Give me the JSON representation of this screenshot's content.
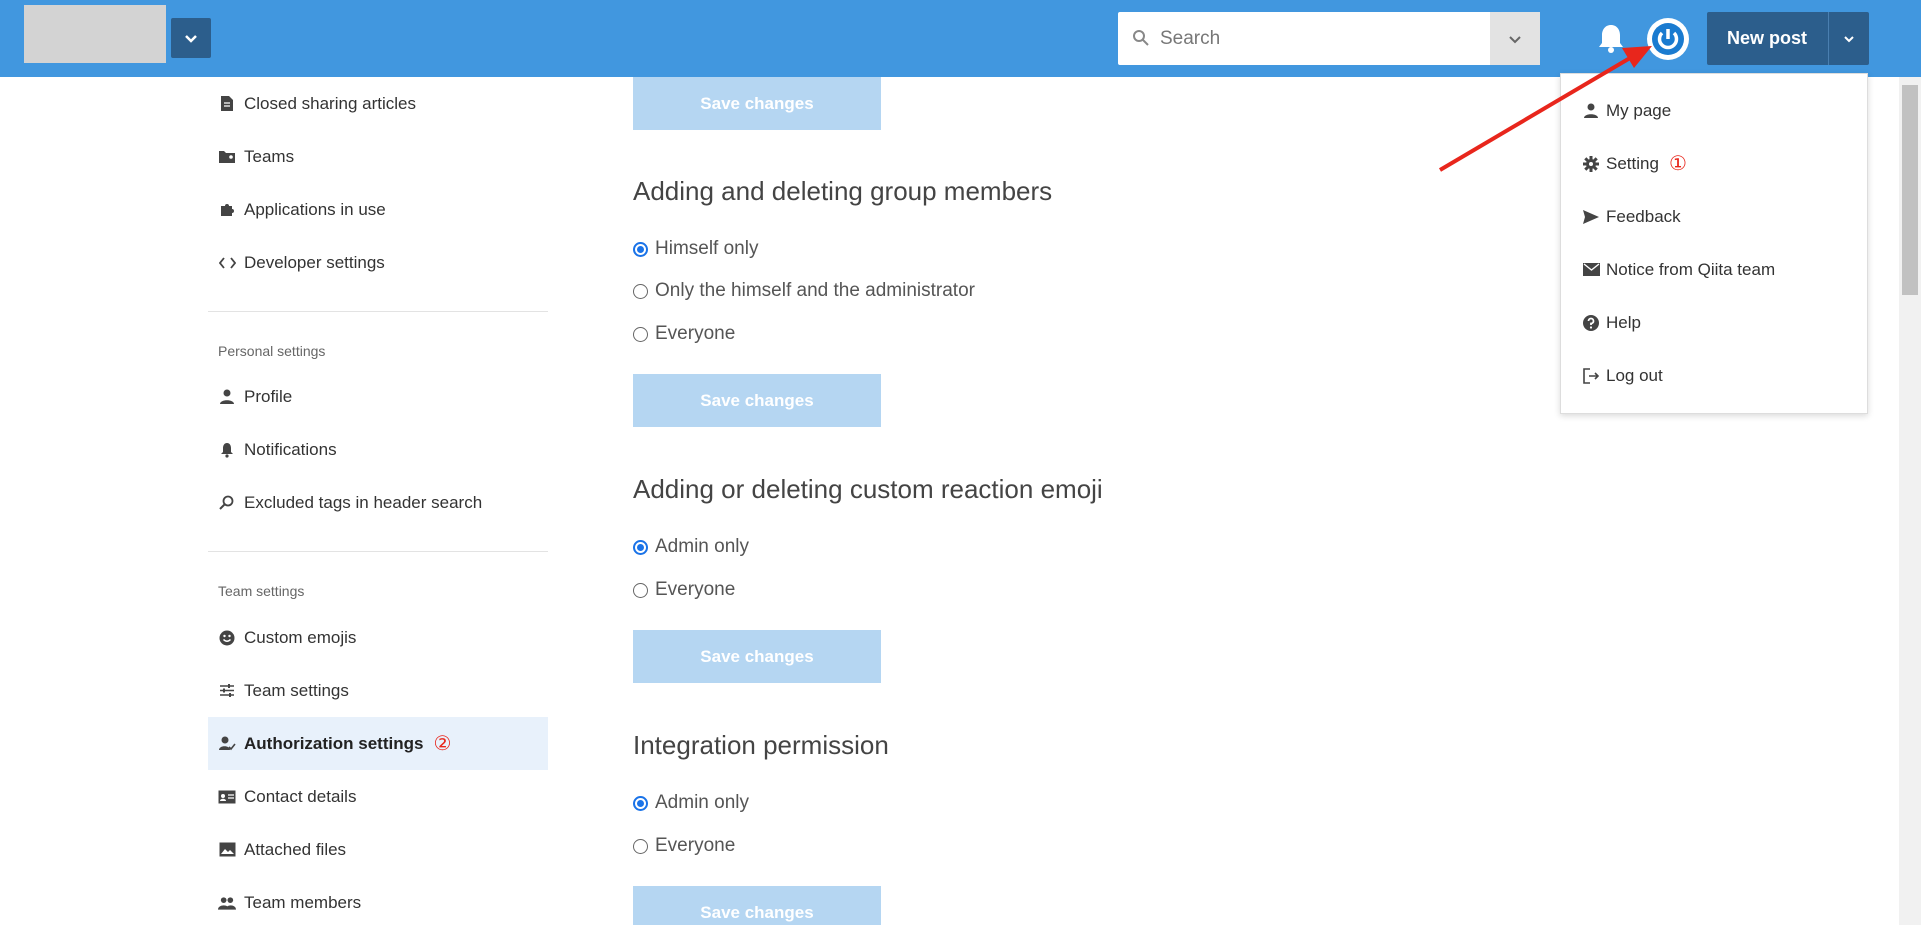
{
  "header": {
    "search_placeholder": "Search",
    "new_post_label": "New post",
    "accent_color": "#4197df",
    "dark_color": "#2c5e8c"
  },
  "sidebar": {
    "top_items": [
      {
        "label": "Closed sharing articles",
        "icon": "document-icon"
      },
      {
        "label": "Teams",
        "icon": "folder-team-icon"
      },
      {
        "label": "Applications in use",
        "icon": "puzzle-icon"
      },
      {
        "label": "Developer settings",
        "icon": "code-icon"
      }
    ],
    "personal_heading": "Personal settings",
    "personal_items": [
      {
        "label": "Profile",
        "icon": "person-icon"
      },
      {
        "label": "Notifications",
        "icon": "bell-icon"
      },
      {
        "label": "Excluded tags in header search",
        "icon": "tag-search-icon"
      }
    ],
    "team_heading": "Team settings",
    "team_items": [
      {
        "label": "Custom emojis",
        "icon": "smiley-icon"
      },
      {
        "label": "Team settings",
        "icon": "sliders-icon"
      },
      {
        "label": "Authorization settings",
        "icon": "user-check-icon",
        "active": true,
        "annotation": "②"
      },
      {
        "label": "Contact details",
        "icon": "contact-card-icon"
      },
      {
        "label": "Attached files",
        "icon": "image-icon"
      },
      {
        "label": "Team members",
        "icon": "people-icon"
      }
    ]
  },
  "main": {
    "save_label": "Save changes",
    "sections": [
      {
        "title": "Adding and deleting group members",
        "options": [
          "Himself only",
          "Only the himself and the administrator",
          "Everyone"
        ],
        "selected": 0
      },
      {
        "title": "Adding or deleting custom reaction emoji",
        "options": [
          "Admin only",
          "Everyone"
        ],
        "selected": 0
      },
      {
        "title": "Integration permission",
        "options": [
          "Admin only",
          "Everyone"
        ],
        "selected": 0
      }
    ]
  },
  "menu": {
    "items": [
      {
        "label": "My page",
        "icon": "person-icon"
      },
      {
        "label": "Setting",
        "icon": "gear-icon",
        "annotation": "①"
      },
      {
        "label": "Feedback",
        "icon": "send-icon"
      },
      {
        "label": "Notice from Qiita team",
        "icon": "mail-icon"
      },
      {
        "label": "Help",
        "icon": "help-icon"
      },
      {
        "label": "Log out",
        "icon": "logout-icon"
      }
    ]
  },
  "annotation_color": "#e8261c"
}
